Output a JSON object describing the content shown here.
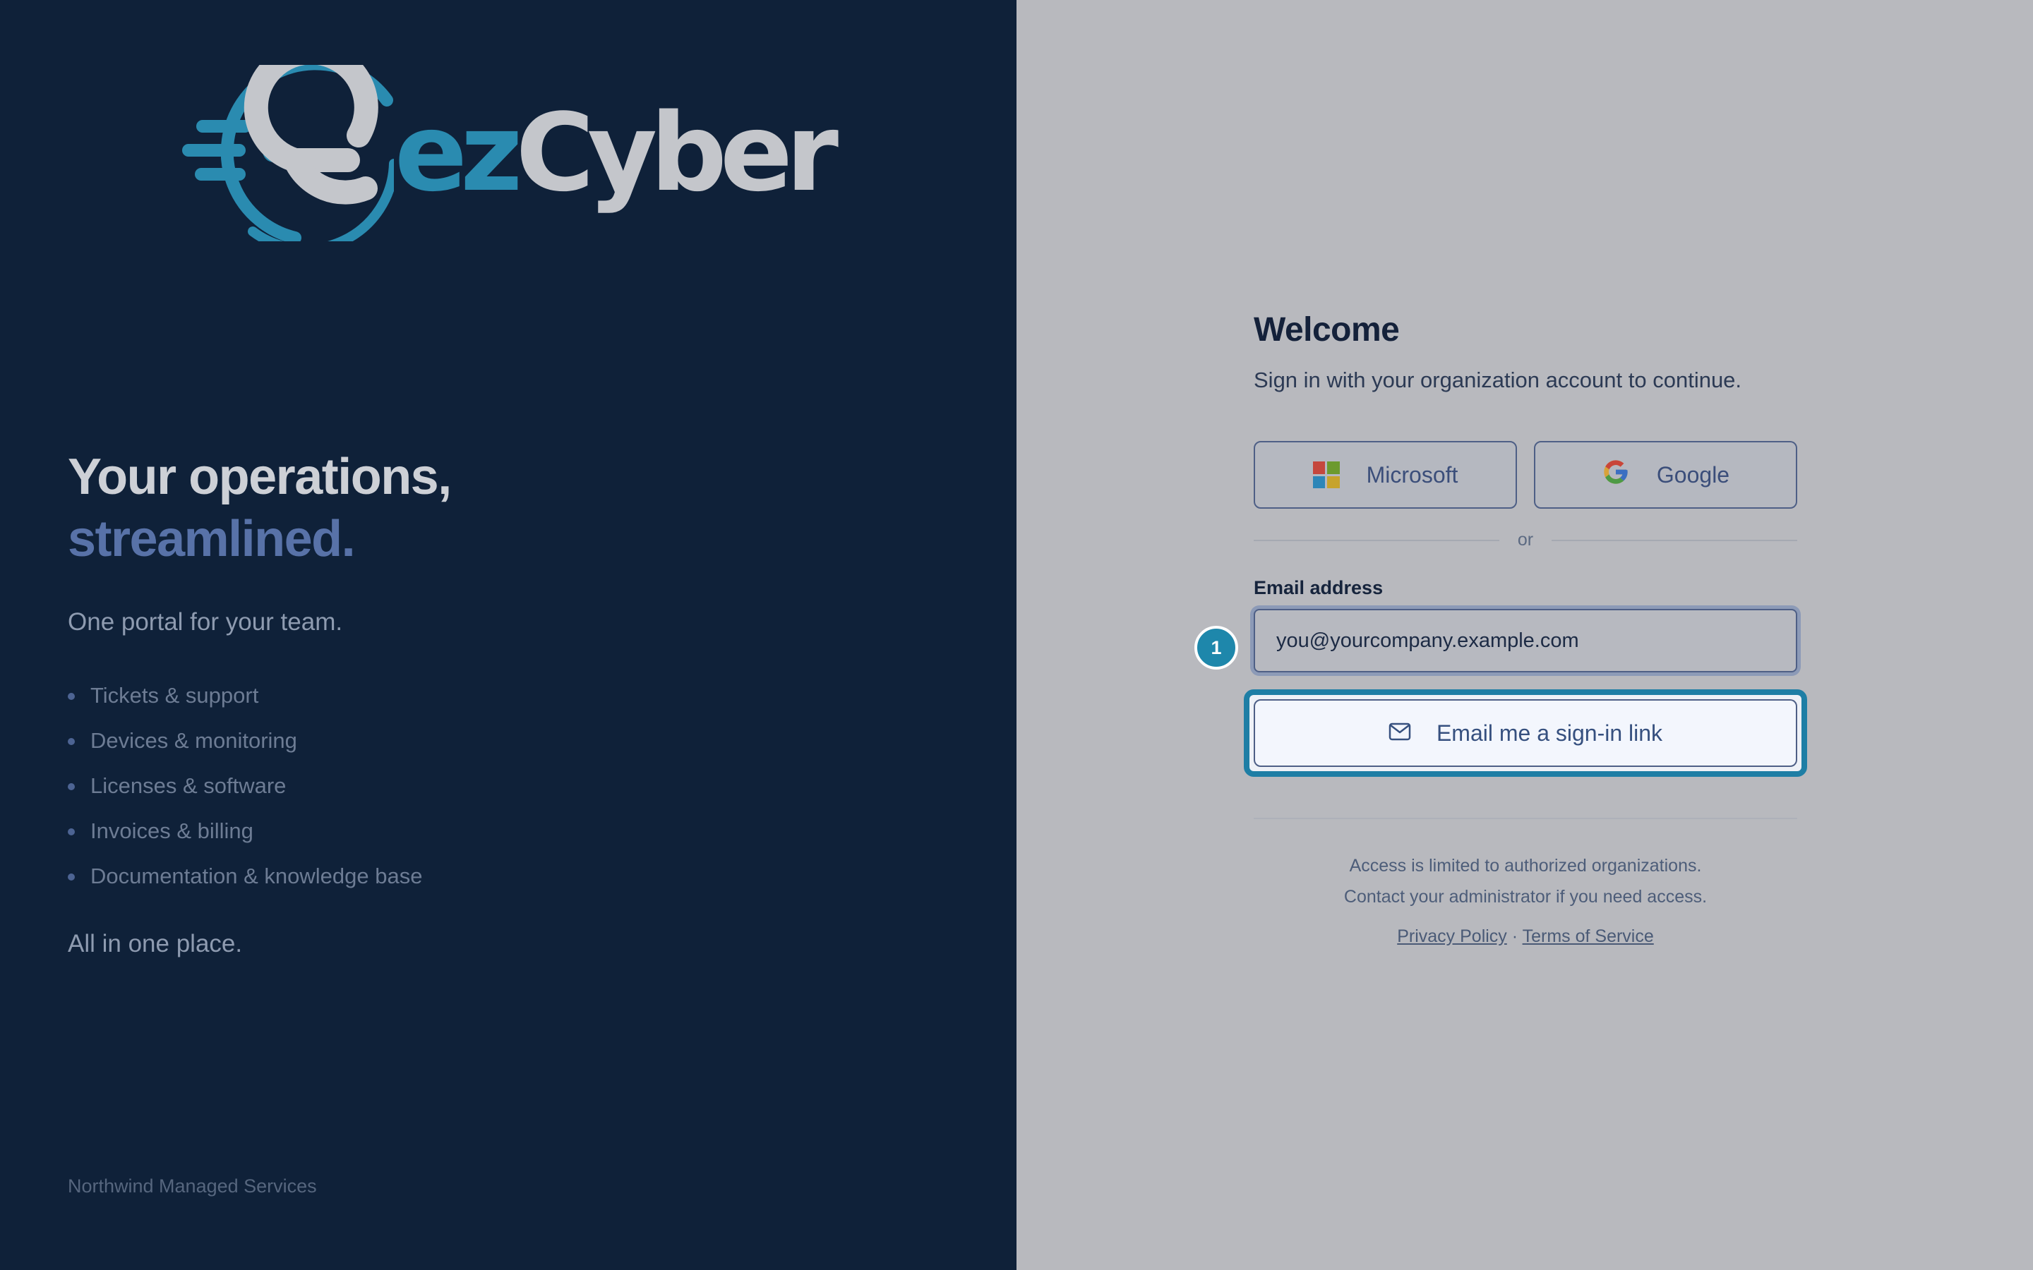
{
  "brand": {
    "name_prefix": "ez",
    "name_suffix": "Cyber",
    "colors": {
      "panel": "#0f2139",
      "accent": "#2a8bb0",
      "logo_light": "#c4c6cb",
      "highlight": "#5872a8"
    }
  },
  "hero": {
    "headline_line1": "Your operations,",
    "headline_line2": "streamlined.",
    "tagline": "One portal for your team.",
    "features": [
      "Tickets & support",
      "Devices & monitoring",
      "Licenses & software",
      "Invoices & billing",
      "Documentation & knowledge base"
    ],
    "closing": "All in one place.",
    "company": "Northwind Managed Services"
  },
  "signin": {
    "title": "Welcome",
    "subtitle": "Sign in with your organization account to continue.",
    "sso": {
      "microsoft_label": "Microsoft",
      "google_label": "Google"
    },
    "divider_text": "or",
    "email_label": "Email address",
    "email_value": "you@yourcompany.example.com",
    "step_badge": "1",
    "submit_label": "Email me a sign-in link",
    "notice_line1": "Access is limited to authorized organizations.",
    "notice_line2": "Contact your administrator if you need access.",
    "privacy_label": "Privacy Policy",
    "separator": "·",
    "terms_label": "Terms of Service"
  },
  "icons": [
    "logo-mark-icon",
    "microsoft-icon",
    "google-icon",
    "mail-icon"
  ]
}
